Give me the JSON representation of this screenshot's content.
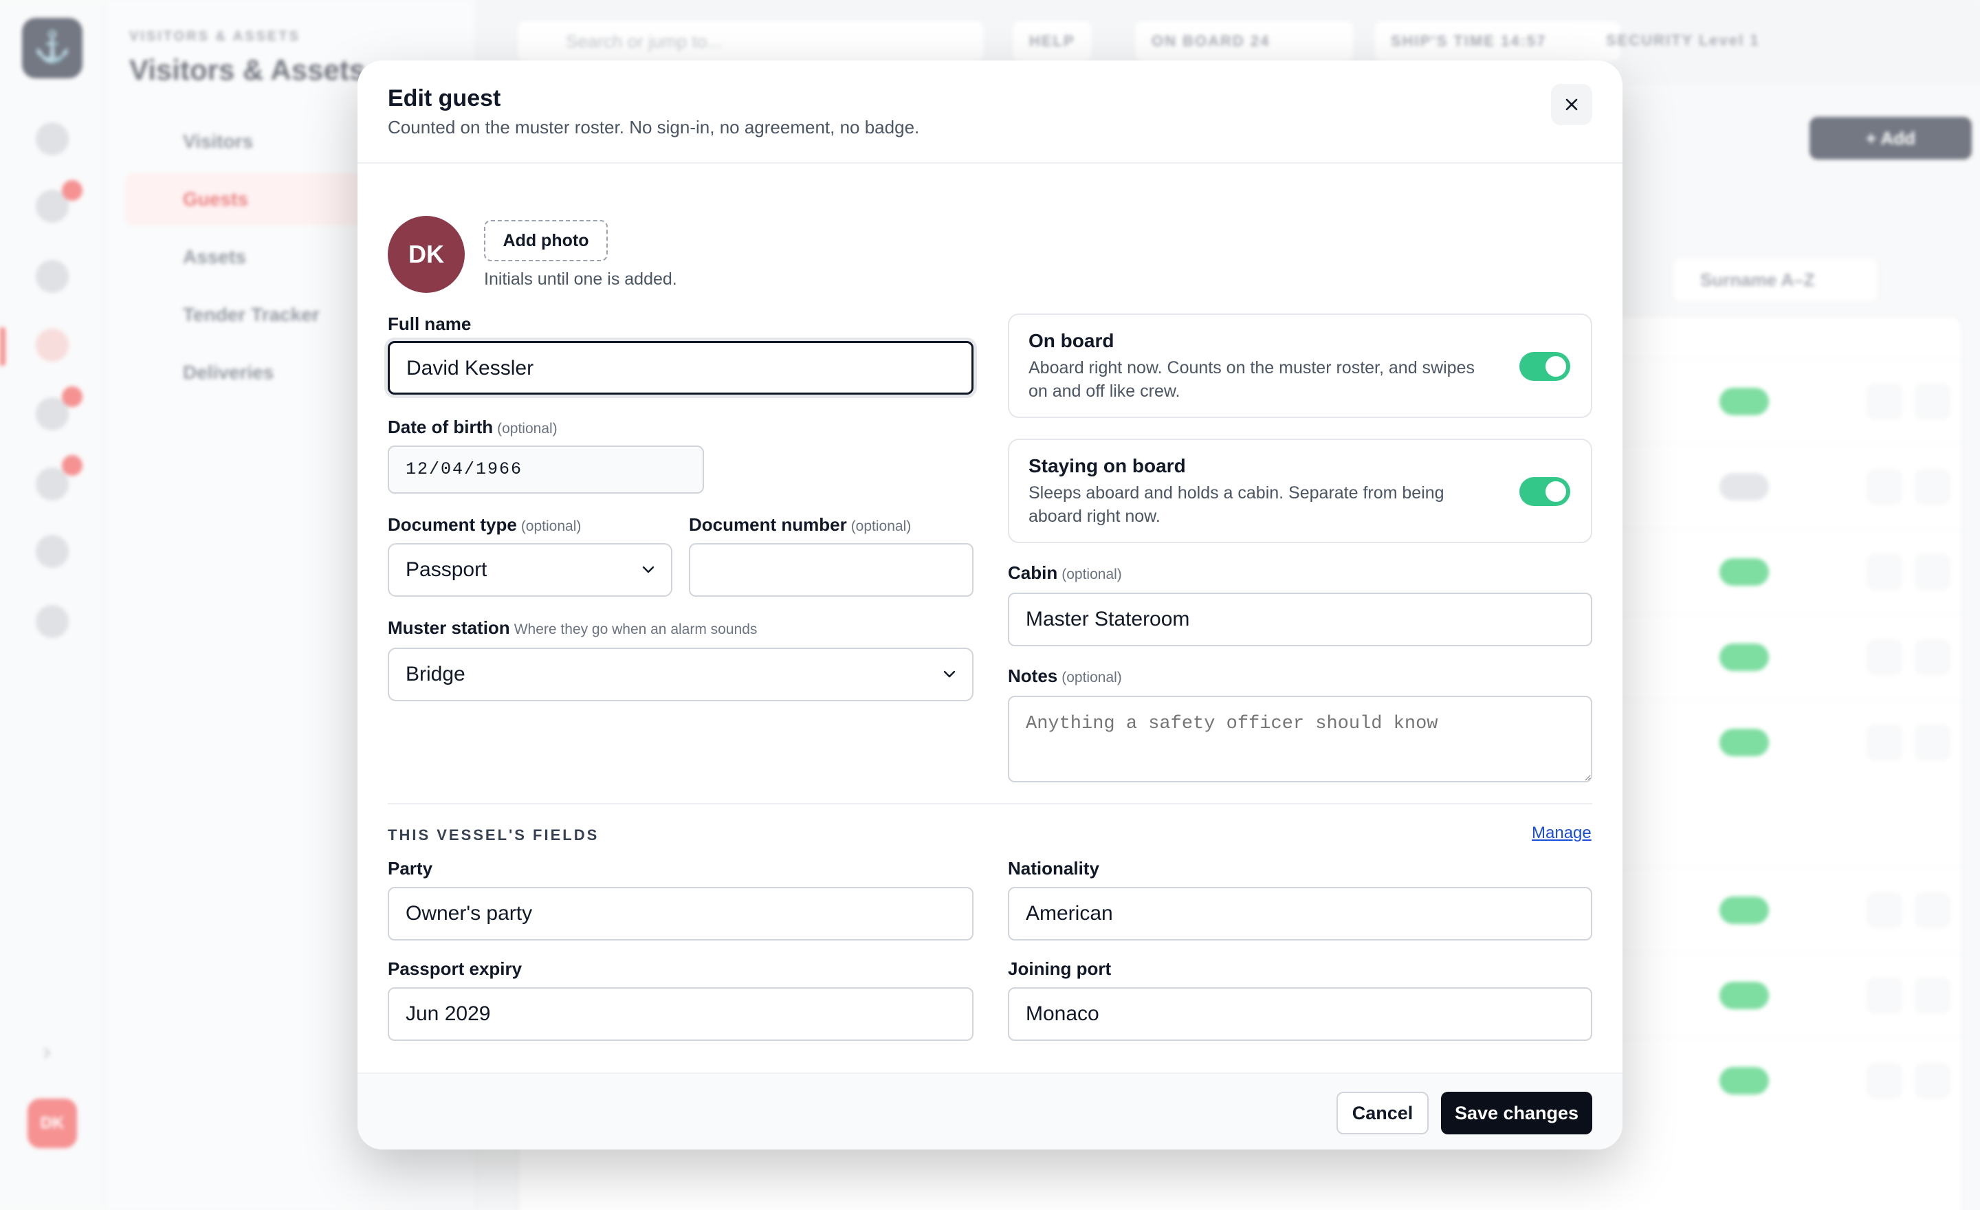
{
  "background": {
    "eyebrow": "VISITORS & ASSETS",
    "title": "Visitors & Assets",
    "nav": [
      "Visitors",
      "Guests",
      "Assets",
      "Tender Tracker",
      "Deliveries"
    ],
    "search_placeholder": "Search or jump to...",
    "topbar": {
      "help": "HELP",
      "on_board_label": "ON BOARD",
      "on_board_count": "24",
      "ships_time_label": "SHIP'S TIME",
      "ships_time": "14:57",
      "security_label": "SECURITY",
      "security_level": "Level 1"
    },
    "add_button": "+ Add",
    "sort_label": "Surname A–Z",
    "user_initials": "DK"
  },
  "modal": {
    "title": "Edit guest",
    "subtitle": "Counted on the muster roster. No sign-in, no agreement, no badge.",
    "avatar_initials": "DK",
    "add_photo": "Add photo",
    "photo_hint": "Initials until one is added.",
    "full_name": {
      "label": "Full name",
      "value": "David Kessler"
    },
    "dob": {
      "label": "Date of birth",
      "optional": "(optional)",
      "value": "12/04/1966"
    },
    "doc_type": {
      "label": "Document type",
      "optional": "(optional)",
      "value": "Passport"
    },
    "doc_number": {
      "label": "Document number",
      "optional": "(optional)",
      "value": ""
    },
    "muster": {
      "label": "Muster station",
      "hint": "Where they go when an alarm sounds",
      "value": "Bridge"
    },
    "on_board": {
      "title": "On board",
      "description": "Aboard right now. Counts on the muster roster, and swipes on and off like crew.",
      "enabled": true
    },
    "staying": {
      "title": "Staying on board",
      "description": "Sleeps aboard and holds a cabin. Separate from being aboard right now.",
      "enabled": true
    },
    "cabin": {
      "label": "Cabin",
      "optional": "(optional)",
      "value": "Master Stateroom"
    },
    "notes": {
      "label": "Notes",
      "optional": "(optional)",
      "placeholder": "Anything a safety officer should know"
    },
    "vessel_fields": {
      "title": "THIS VESSEL'S FIELDS",
      "manage": "Manage",
      "party": {
        "label": "Party",
        "value": "Owner's party"
      },
      "nationality": {
        "label": "Nationality",
        "value": "American"
      },
      "passport_expiry": {
        "label": "Passport expiry",
        "value": "Jun 2029"
      },
      "joining_port": {
        "label": "Joining port",
        "value": "Monaco"
      }
    },
    "cancel": "Cancel",
    "save": "Save changes"
  },
  "colors": {
    "avatar": "#8b3a4a",
    "toggle_on": "#34c78a",
    "primary_button": "#0b0f19",
    "link": "#1d4ed8"
  }
}
